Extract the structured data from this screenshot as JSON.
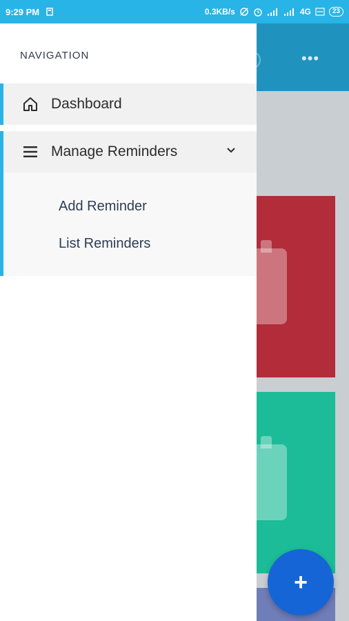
{
  "status_bar": {
    "time": "9:29 PM",
    "speed": "0.3KB/s",
    "network": "4G",
    "battery": "23"
  },
  "drawer": {
    "heading": "NAVIGATION",
    "items": [
      {
        "label": "Dashboard",
        "icon": "home-icon"
      },
      {
        "label": "Manage Reminders",
        "icon": "menu-icon",
        "expanded": true,
        "children": [
          {
            "label": "Add Reminder"
          },
          {
            "label": "List Reminders"
          }
        ]
      }
    ]
  },
  "colors": {
    "status_bar": "#28b4e6",
    "accent": "#28b4e6",
    "card_red": "#b22c3a",
    "card_green": "#1cbc98",
    "fab": "#1565d6"
  },
  "fab": {
    "label": "+"
  }
}
